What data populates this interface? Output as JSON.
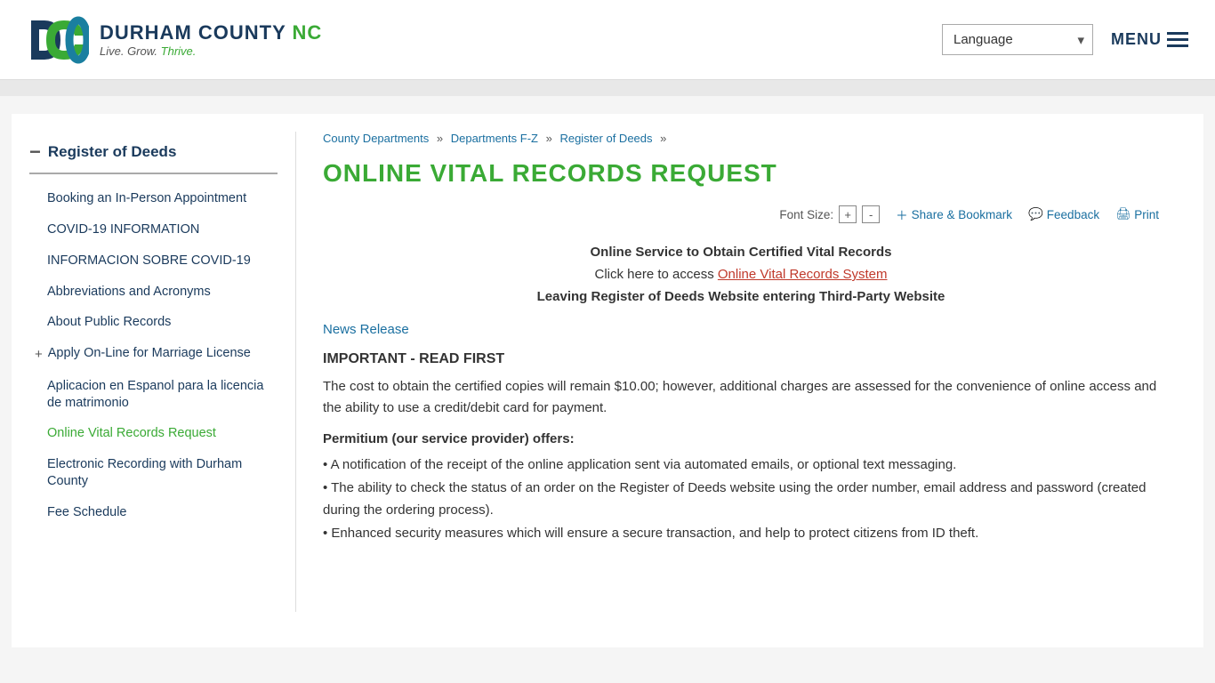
{
  "header": {
    "logo_line1": "DURHAM COUNTY",
    "logo_nc": "NC",
    "logo_tagline_1": "Live. Grow.",
    "logo_tagline_2": "Thrive.",
    "language_label": "Language",
    "menu_label": "MENU"
  },
  "sidebar": {
    "title": "Register of Deeds",
    "items": [
      {
        "label": "Booking an In-Person Appointment",
        "active": false,
        "has_plus": false
      },
      {
        "label": "COVID-19 INFORMATION",
        "active": false,
        "has_plus": false
      },
      {
        "label": "INFORMACION SOBRE COVID-19",
        "active": false,
        "has_plus": false
      },
      {
        "label": "Abbreviations and Acronyms",
        "active": false,
        "has_plus": false
      },
      {
        "label": "About Public Records",
        "active": false,
        "has_plus": false
      },
      {
        "label": "Apply On-Line for Marriage License",
        "active": false,
        "has_plus": true
      },
      {
        "label": "Aplicacion en Espanol para la licencia de matrimonio",
        "active": false,
        "has_plus": false
      },
      {
        "label": "Online Vital Records Request",
        "active": true,
        "has_plus": false
      },
      {
        "label": "Electronic Recording with Durham County",
        "active": false,
        "has_plus": false
      },
      {
        "label": "Fee Schedule",
        "active": false,
        "has_plus": false
      }
    ]
  },
  "breadcrumb": {
    "items": [
      {
        "label": "County Departments",
        "href": "#"
      },
      {
        "label": "Departments F-Z",
        "href": "#"
      },
      {
        "label": "Register of Deeds",
        "href": "#"
      }
    ]
  },
  "page": {
    "title": "ONLINE VITAL RECORDS REQUEST",
    "font_size_label": "Font Size:",
    "font_plus": "+",
    "font_minus": "-",
    "share_label": "Share & Bookmark",
    "feedback_label": "Feedback",
    "print_label": "Print",
    "intro_text": "Online Service to Obtain Certified Vital Records",
    "click_text": "Click here to access",
    "vital_records_link": "Online Vital Records System",
    "leaving_notice": "Leaving Register of Deeds Website entering Third-Party Website",
    "news_release_label": "News Release",
    "important_heading": "IMPORTANT - READ FIRST",
    "cost_text": "The cost to obtain the certified copies will remain $10.00; however, additional charges are assessed for the convenience of online access and the ability to use a credit/debit card for payment.",
    "permitium_heading": "Permitium (our service provider) offers:",
    "bullet_1": "• A notification of the receipt of the online application sent via automated emails, or optional text messaging.",
    "bullet_2": "• The ability to check the status of an order on the Register of Deeds website using the order number, email address and password (created during the ordering process).",
    "bullet_3": "• Enhanced security measures which will ensure a secure transaction, and help to protect citizens from ID theft."
  }
}
